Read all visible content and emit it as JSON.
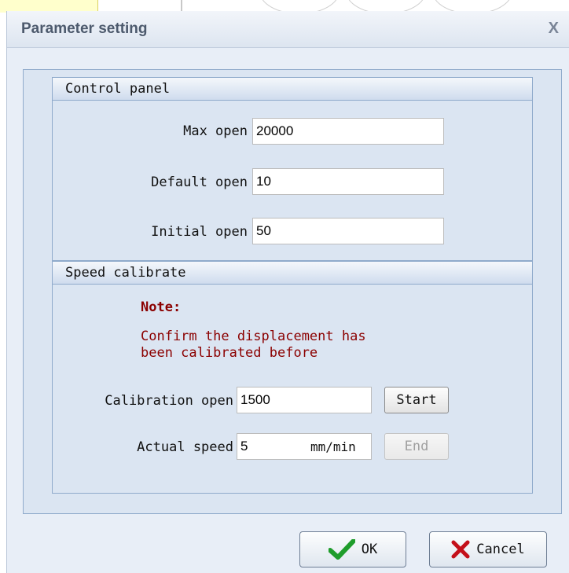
{
  "dialog": {
    "title": "Parameter setting",
    "close_label": "X"
  },
  "control_panel": {
    "title": "Control panel",
    "max_open": {
      "label": "Max open",
      "value": "20000"
    },
    "default_open": {
      "label": "Default open",
      "value": "10"
    },
    "initial_open": {
      "label": "Initial open",
      "value": "50"
    }
  },
  "speed_calibrate": {
    "title": "Speed calibrate",
    "note_title": "Note:",
    "note_line1": "Confirm the displacement has",
    "note_line2": "been calibrated before",
    "calibration_open": {
      "label": "Calibration open",
      "value": "1500"
    },
    "start_label": "Start",
    "actual_speed": {
      "label": "Actual speed",
      "value": "5",
      "unit": "mm/min"
    },
    "end_label": "End"
  },
  "buttons": {
    "ok_label": "OK",
    "cancel_label": "Cancel"
  },
  "icons": {
    "ok_icon": "check-icon",
    "cancel_icon": "cross-icon",
    "ok_color": "#1f9d2b",
    "cancel_color": "#c4101a"
  }
}
